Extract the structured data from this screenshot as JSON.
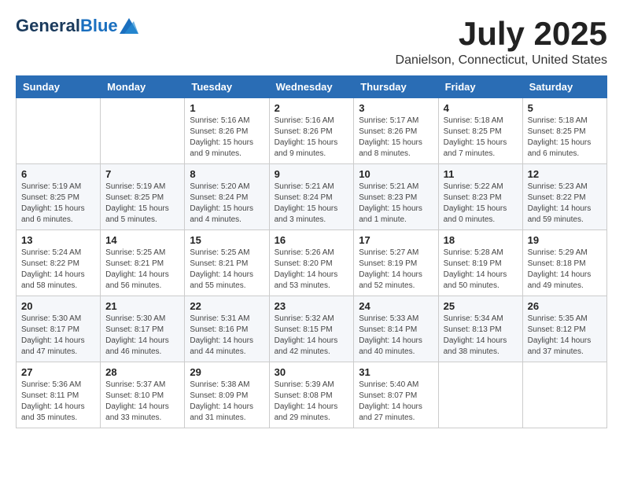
{
  "header": {
    "logo_general": "General",
    "logo_blue": "Blue",
    "month": "July 2025",
    "location": "Danielson, Connecticut, United States"
  },
  "days_of_week": [
    "Sunday",
    "Monday",
    "Tuesday",
    "Wednesday",
    "Thursday",
    "Friday",
    "Saturday"
  ],
  "weeks": [
    [
      {
        "day": "",
        "detail": ""
      },
      {
        "day": "",
        "detail": ""
      },
      {
        "day": "1",
        "detail": "Sunrise: 5:16 AM\nSunset: 8:26 PM\nDaylight: 15 hours and 9 minutes."
      },
      {
        "day": "2",
        "detail": "Sunrise: 5:16 AM\nSunset: 8:26 PM\nDaylight: 15 hours and 9 minutes."
      },
      {
        "day": "3",
        "detail": "Sunrise: 5:17 AM\nSunset: 8:26 PM\nDaylight: 15 hours and 8 minutes."
      },
      {
        "day": "4",
        "detail": "Sunrise: 5:18 AM\nSunset: 8:25 PM\nDaylight: 15 hours and 7 minutes."
      },
      {
        "day": "5",
        "detail": "Sunrise: 5:18 AM\nSunset: 8:25 PM\nDaylight: 15 hours and 6 minutes."
      }
    ],
    [
      {
        "day": "6",
        "detail": "Sunrise: 5:19 AM\nSunset: 8:25 PM\nDaylight: 15 hours and 6 minutes."
      },
      {
        "day": "7",
        "detail": "Sunrise: 5:19 AM\nSunset: 8:25 PM\nDaylight: 15 hours and 5 minutes."
      },
      {
        "day": "8",
        "detail": "Sunrise: 5:20 AM\nSunset: 8:24 PM\nDaylight: 15 hours and 4 minutes."
      },
      {
        "day": "9",
        "detail": "Sunrise: 5:21 AM\nSunset: 8:24 PM\nDaylight: 15 hours and 3 minutes."
      },
      {
        "day": "10",
        "detail": "Sunrise: 5:21 AM\nSunset: 8:23 PM\nDaylight: 15 hours and 1 minute."
      },
      {
        "day": "11",
        "detail": "Sunrise: 5:22 AM\nSunset: 8:23 PM\nDaylight: 15 hours and 0 minutes."
      },
      {
        "day": "12",
        "detail": "Sunrise: 5:23 AM\nSunset: 8:22 PM\nDaylight: 14 hours and 59 minutes."
      }
    ],
    [
      {
        "day": "13",
        "detail": "Sunrise: 5:24 AM\nSunset: 8:22 PM\nDaylight: 14 hours and 58 minutes."
      },
      {
        "day": "14",
        "detail": "Sunrise: 5:25 AM\nSunset: 8:21 PM\nDaylight: 14 hours and 56 minutes."
      },
      {
        "day": "15",
        "detail": "Sunrise: 5:25 AM\nSunset: 8:21 PM\nDaylight: 14 hours and 55 minutes."
      },
      {
        "day": "16",
        "detail": "Sunrise: 5:26 AM\nSunset: 8:20 PM\nDaylight: 14 hours and 53 minutes."
      },
      {
        "day": "17",
        "detail": "Sunrise: 5:27 AM\nSunset: 8:19 PM\nDaylight: 14 hours and 52 minutes."
      },
      {
        "day": "18",
        "detail": "Sunrise: 5:28 AM\nSunset: 8:19 PM\nDaylight: 14 hours and 50 minutes."
      },
      {
        "day": "19",
        "detail": "Sunrise: 5:29 AM\nSunset: 8:18 PM\nDaylight: 14 hours and 49 minutes."
      }
    ],
    [
      {
        "day": "20",
        "detail": "Sunrise: 5:30 AM\nSunset: 8:17 PM\nDaylight: 14 hours and 47 minutes."
      },
      {
        "day": "21",
        "detail": "Sunrise: 5:30 AM\nSunset: 8:17 PM\nDaylight: 14 hours and 46 minutes."
      },
      {
        "day": "22",
        "detail": "Sunrise: 5:31 AM\nSunset: 8:16 PM\nDaylight: 14 hours and 44 minutes."
      },
      {
        "day": "23",
        "detail": "Sunrise: 5:32 AM\nSunset: 8:15 PM\nDaylight: 14 hours and 42 minutes."
      },
      {
        "day": "24",
        "detail": "Sunrise: 5:33 AM\nSunset: 8:14 PM\nDaylight: 14 hours and 40 minutes."
      },
      {
        "day": "25",
        "detail": "Sunrise: 5:34 AM\nSunset: 8:13 PM\nDaylight: 14 hours and 38 minutes."
      },
      {
        "day": "26",
        "detail": "Sunrise: 5:35 AM\nSunset: 8:12 PM\nDaylight: 14 hours and 37 minutes."
      }
    ],
    [
      {
        "day": "27",
        "detail": "Sunrise: 5:36 AM\nSunset: 8:11 PM\nDaylight: 14 hours and 35 minutes."
      },
      {
        "day": "28",
        "detail": "Sunrise: 5:37 AM\nSunset: 8:10 PM\nDaylight: 14 hours and 33 minutes."
      },
      {
        "day": "29",
        "detail": "Sunrise: 5:38 AM\nSunset: 8:09 PM\nDaylight: 14 hours and 31 minutes."
      },
      {
        "day": "30",
        "detail": "Sunrise: 5:39 AM\nSunset: 8:08 PM\nDaylight: 14 hours and 29 minutes."
      },
      {
        "day": "31",
        "detail": "Sunrise: 5:40 AM\nSunset: 8:07 PM\nDaylight: 14 hours and 27 minutes."
      },
      {
        "day": "",
        "detail": ""
      },
      {
        "day": "",
        "detail": ""
      }
    ]
  ]
}
